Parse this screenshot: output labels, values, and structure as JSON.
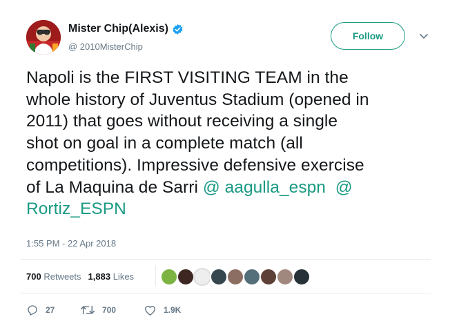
{
  "user": {
    "name": "Mister Chip(Alexis)",
    "handle": "@ 2010MisterChip"
  },
  "follow_label": "Follow",
  "tweet": {
    "lines": [
      "Napoli is the FIRST VISITING TEAM in the",
      "whole history of Juventus Stadium (opened in",
      "2011) that goes without receiving a single",
      "shot on goal in a complete match (all",
      "competitions). Impressive defensive exercise"
    ],
    "line6_text": "of La Maquina de Sarri ",
    "mention1": "@ aagulla_espn",
    "mention2": "@",
    "mention2b": "Rortiz_ESPN",
    "timestamp": "1:55 PM - 22 Apr 2018"
  },
  "stats": {
    "retweets_count": "700",
    "retweets_label": "Retweets",
    "likes_count": "1,883",
    "likes_label": "Likes"
  },
  "actions": {
    "reply_count": "27",
    "retweet_count": "700",
    "like_count": "1.9K"
  },
  "colors": {
    "accent": "#1a9a83",
    "secondary_text": "#657786",
    "primary_text": "#14171a",
    "verified": "#1da1f2"
  },
  "icons": [
    "verified-badge-icon",
    "chevron-down-icon",
    "reply-icon",
    "retweet-icon",
    "heart-icon"
  ]
}
